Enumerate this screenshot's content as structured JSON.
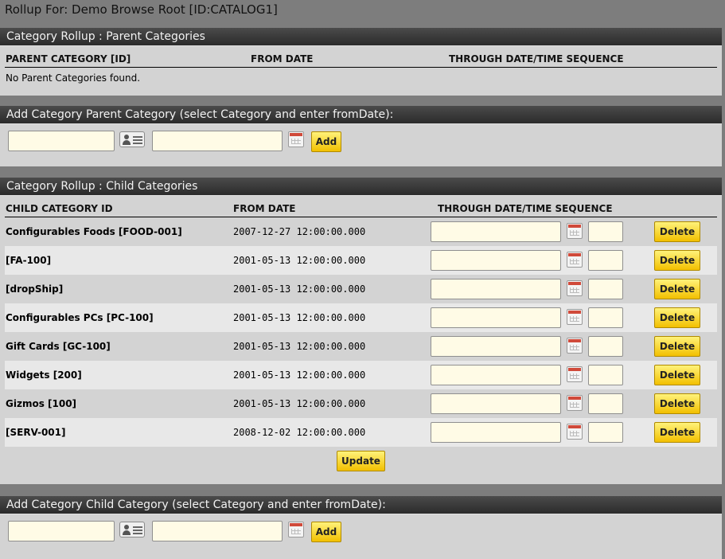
{
  "page_title": "Rollup For: Demo Browse Root [ID:CATALOG1]",
  "parent_categories": {
    "title": "Category Rollup : Parent Categories",
    "columns": [
      "PARENT CATEGORY [ID]",
      "FROM DATE",
      "THROUGH DATE/TIME SEQUENCE"
    ],
    "empty_message": "No Parent Categories found."
  },
  "add_parent": {
    "title": "Add Category Parent Category (select Category and enter fromDate):",
    "category_value": "",
    "from_date_value": "",
    "add_label": "Add",
    "lookup_icon": "lookup-card-icon",
    "calendar_icon": "calendar-icon"
  },
  "child_categories": {
    "title": "Category Rollup : Child Categories",
    "columns": [
      "CHILD CATEGORY ID",
      "FROM DATE",
      "THROUGH DATE/TIME SEQUENCE"
    ],
    "rows": [
      {
        "name": "Configurables Foods [FOOD-001]",
        "from_date": "2007-12-27 12:00:00.000",
        "through_date": "",
        "sequence": ""
      },
      {
        "name": "[FA-100]",
        "from_date": "2001-05-13 12:00:00.000",
        "through_date": "",
        "sequence": ""
      },
      {
        "name": "[dropShip]",
        "from_date": "2001-05-13 12:00:00.000",
        "through_date": "",
        "sequence": ""
      },
      {
        "name": "Configurables PCs [PC-100]",
        "from_date": "2001-05-13 12:00:00.000",
        "through_date": "",
        "sequence": ""
      },
      {
        "name": "Gift Cards [GC-100]",
        "from_date": "2001-05-13 12:00:00.000",
        "through_date": "",
        "sequence": ""
      },
      {
        "name": "Widgets [200]",
        "from_date": "2001-05-13 12:00:00.000",
        "through_date": "",
        "sequence": ""
      },
      {
        "name": "Gizmos [100]",
        "from_date": "2001-05-13 12:00:00.000",
        "through_date": "",
        "sequence": ""
      },
      {
        "name": "[SERV-001]",
        "from_date": "2008-12-02 12:00:00.000",
        "through_date": "",
        "sequence": ""
      }
    ],
    "delete_label": "Delete",
    "update_label": "Update"
  },
  "add_child": {
    "title": "Add Category Child Category (select Category and enter fromDate):",
    "category_value": "",
    "from_date_value": "",
    "add_label": "Add"
  },
  "colors": {
    "background": "#7d7d7d",
    "panel": "#d3d3d3",
    "header": "#2b2b2b",
    "input": "#fffbe6",
    "button": "#f2c000"
  }
}
